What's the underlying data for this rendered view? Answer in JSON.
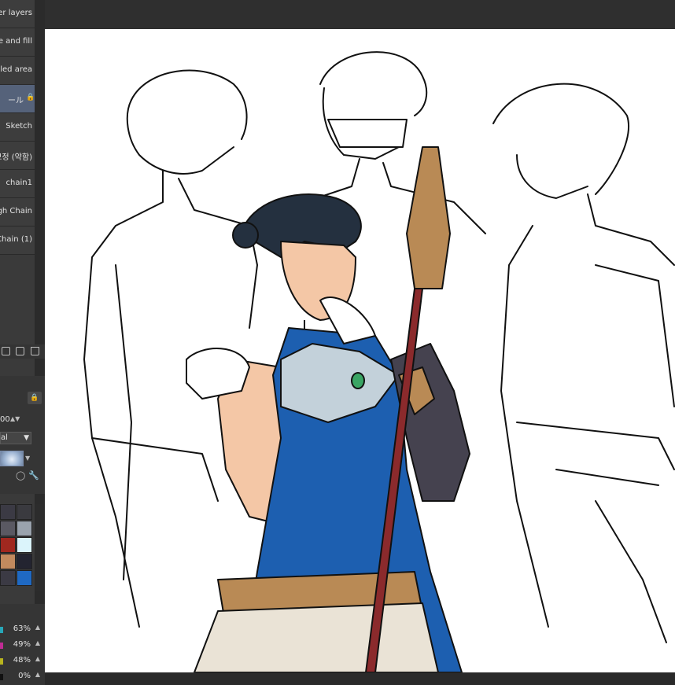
{
  "layers": [
    {
      "label": "er layers",
      "selected": false
    },
    {
      "label": "e and fill",
      "selected": false
    },
    {
      "label": "lled area",
      "selected": false
    },
    {
      "label": "ール",
      "selected": true,
      "locked": true
    },
    {
      "label": "Sketch",
      "selected": false
    },
    {
      "label": "보정 (약함)",
      "selected": false
    },
    {
      "label": "chain1",
      "selected": false
    },
    {
      "label": "gh Chain",
      "selected": false
    },
    {
      "label": "Chain (1)",
      "selected": false
    }
  ],
  "layer_tools": [
    "merge-down-icon",
    "new-layer-icon",
    "delete-layer-icon"
  ],
  "properties": {
    "opacity": "00",
    "blend_mode": "al"
  },
  "palette_colors": [
    "#3b3a44",
    "#3a3a3f",
    "#5a5962",
    "#9aa3ad",
    "#a0281f",
    "#dbf4fb",
    "#c28a5e",
    "#232430",
    "#3b3a44",
    "#1f69c3"
  ],
  "color_mix": [
    {
      "value": "63%",
      "color": "#27a7b8"
    },
    {
      "value": "49%",
      "color": "#c02c94"
    },
    {
      "value": "48%",
      "color": "#b8b41e"
    },
    {
      "value": "0%",
      "color": "#111111"
    }
  ],
  "colors": {
    "panel_bg": "#3a3a3a",
    "selected_layer": "#55627a",
    "canvas": "#ffffff",
    "line_art": "#111111",
    "hair": "#24303f",
    "skin": "#f4c7a6",
    "outfit_blue": "#1d5fb0",
    "armor_gray": "#c3d1da",
    "gauntlet_dark": "#45424f",
    "gold_trim": "#b98a55",
    "staff_red": "#8b2a2c"
  }
}
